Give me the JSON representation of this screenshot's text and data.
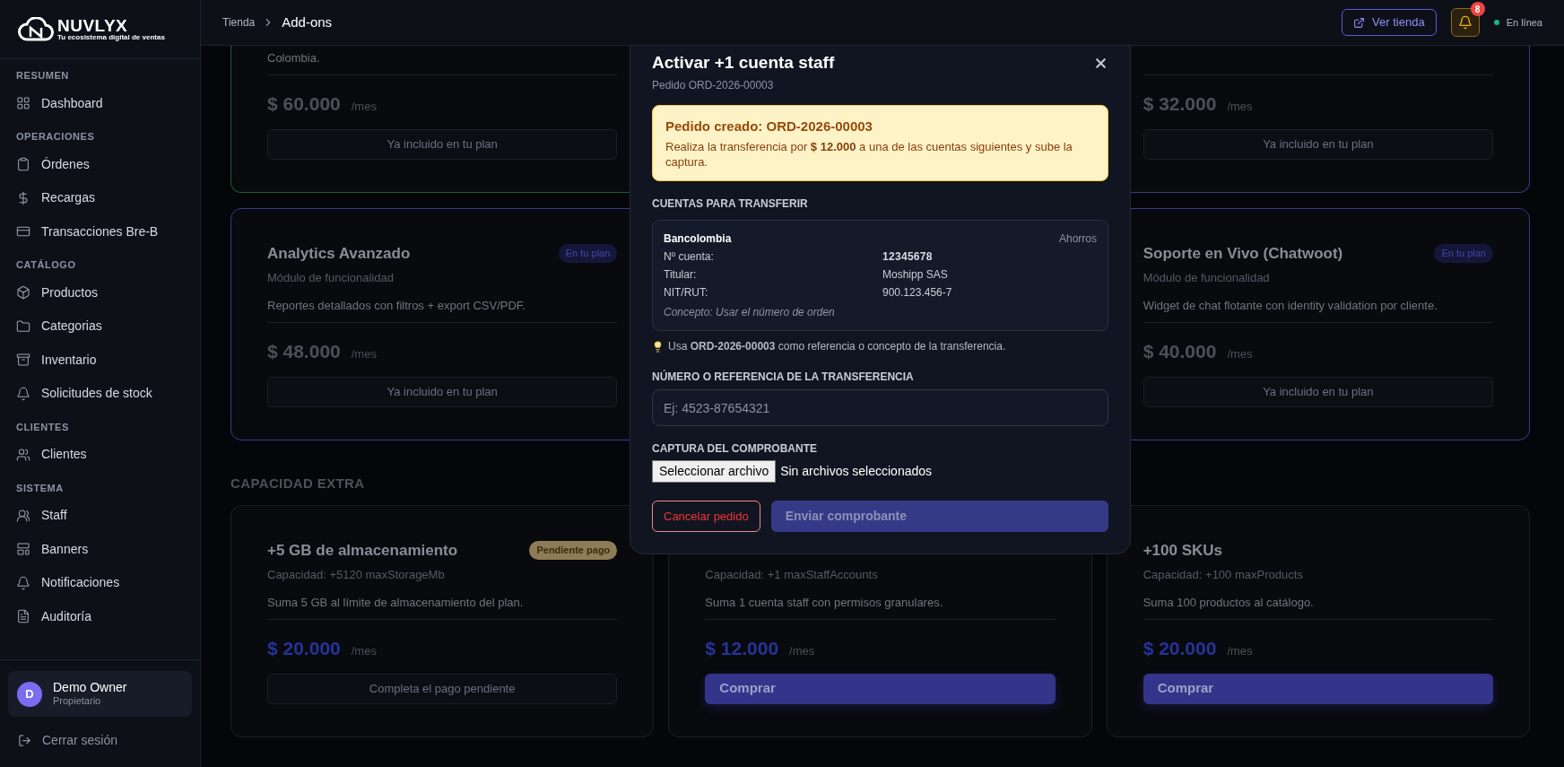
{
  "brand": {
    "name": "NUVLYX",
    "tagline": "Tu ecosistema digital de ventas"
  },
  "sidebar": {
    "sections": [
      {
        "title": "RESUMEN",
        "items": [
          {
            "label": "Dashboard"
          }
        ]
      },
      {
        "title": "OPERACIONES",
        "items": [
          {
            "label": "Órdenes"
          },
          {
            "label": "Recargas"
          },
          {
            "label": "Transacciones Bre-B"
          }
        ]
      },
      {
        "title": "CATÁLOGO",
        "items": [
          {
            "label": "Productos"
          },
          {
            "label": "Categorias"
          },
          {
            "label": "Inventario"
          },
          {
            "label": "Solicitudes de stock"
          }
        ]
      },
      {
        "title": "CLIENTES",
        "items": [
          {
            "label": "Clientes"
          }
        ]
      },
      {
        "title": "SISTEMA",
        "items": [
          {
            "label": "Staff"
          },
          {
            "label": "Banners"
          },
          {
            "label": "Notificaciones"
          },
          {
            "label": "Auditoría"
          }
        ]
      }
    ],
    "user": {
      "initial": "D",
      "name": "Demo Owner",
      "role": "Propietario"
    },
    "logout": "Cerrar sesión"
  },
  "header": {
    "breadcrumb": [
      {
        "label": "Tienda"
      },
      {
        "label": "Add-ons"
      }
    ],
    "store_button": "Ver tienda",
    "notifications": "8",
    "status": "En línea"
  },
  "rows": [
    {
      "cards": [
        {
          "description": "Colombia.",
          "price": "$ 60.000",
          "period": "/mes",
          "button": {
            "label": "Ya incluido en tu plan",
            "kind": "included"
          },
          "color": "#1f5a32"
        },
        {
          "price": "$ 32.000",
          "period": "/mes",
          "button": {
            "label": "Ya incluido en tu plan",
            "kind": "included"
          },
          "color": "#3a3a8c"
        }
      ]
    },
    {
      "cards": [
        {
          "title": "Analytics Avanzado",
          "badge": {
            "label": "En tu plan",
            "kind": "plan"
          },
          "subtitle": "Módulo de funcionalidad",
          "description": "Reportes detallados con filtros + export CSV/PDF.",
          "price": "$ 48.000",
          "period": "/mes",
          "button": {
            "label": "Ya incluido en tu plan",
            "kind": "included"
          },
          "color": "#3a3a8c"
        },
        {
          "title": "Soporte en Vivo (Chatwoot)",
          "badge": {
            "label": "En tu plan",
            "kind": "plan"
          },
          "subtitle": "Módulo de funcionalidad",
          "description": "Widget de chat flotante con identity validation por cliente.",
          "price": "$ 40.000",
          "period": "/mes",
          "button": {
            "label": "Ya incluido en tu plan",
            "kind": "included"
          },
          "color": "#3a3a8c"
        }
      ]
    },
    {
      "heading": "CAPACIDAD EXTRA",
      "cards": [
        {
          "title": "+5 GB de almacenamiento",
          "badge": {
            "label": "Pendiente pago",
            "kind": "pending"
          },
          "subtitle": "Capacidad: +5120 maxStorageMb",
          "description": "Suma 5 GB al límite de almacenamiento del plan.",
          "price": "$ 20.000",
          "period": "/mes",
          "button": {
            "label": "Completa el pago pendiente",
            "kind": "pending"
          },
          "color": "#1c1f26"
        },
        {
          "subtitle": "Capacidad: +1 maxStaffAccounts",
          "description": "Suma 1 cuenta staff con permisos granulares.",
          "price": "$ 12.000",
          "period": "/mes",
          "button": {
            "label": "Comprar",
            "kind": "buy"
          },
          "color": "#1c1f26"
        },
        {
          "title": "+100 SKUs",
          "subtitle": "Capacidad: +100 maxProducts",
          "description": "Suma 100 productos al catálogo.",
          "price": "$ 20.000",
          "period": "/mes",
          "button": {
            "label": "Comprar",
            "kind": "buy"
          },
          "color": "#1c1f26"
        }
      ]
    }
  ],
  "modal": {
    "title": "Activar +1 cuenta staff",
    "subtitle": "Pedido ORD-2026-00003",
    "alert": {
      "title": "Pedido creado: ORD-2026-00003",
      "text": "Realiza la transferencia por **$ 12.000** a una de las cuentas siguientes y sube la captura."
    },
    "accounts_heading": "CUENTAS PARA TRANSFERIR",
    "accounts": [
      {
        "bank": "Bancolombia",
        "type": "Ahorros",
        "fields": [
          {
            "label": "Nº cuenta:",
            "value": "12345678",
            "emphasis": true
          },
          {
            "label": "Titular:",
            "value": "Moshipp SAS",
            "emphasis": false
          },
          {
            "label": "NIT/RUT:",
            "value": "900.123.456-7",
            "emphasis": false
          }
        ],
        "concept": "Concepto: Usar el número de orden"
      }
    ],
    "tip": "Usa **ORD-2026-00003** como referencia o concepto de la transferencia.",
    "reference_label": "NÚMERO O REFERENCIA DE LA TRANSFERENCIA",
    "reference_field": {
      "placeholder": "Ej: 4523-87654321"
    },
    "upload_label": "CAPTURA DEL COMPROBANTE",
    "file_button": "Seleccionar archivo",
    "file_status": "Sin archivos seleccionados",
    "cancel_button": "Cancelar pedido",
    "submit_button": {
      "label": "Enviar comprobante",
      "disabled": true
    }
  }
}
